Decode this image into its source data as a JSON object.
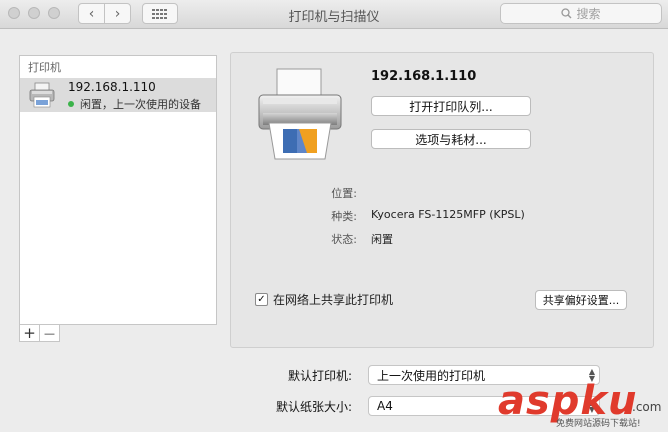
{
  "window": {
    "title": "打印机与扫描仪",
    "search_placeholder": "搜索",
    "back_glyph": "‹",
    "forward_glyph": "›",
    "grid_glyph": "⋮⋮⋮"
  },
  "sidebar": {
    "header": "打印机",
    "printers": [
      {
        "name": "192.168.1.110",
        "status": "闲置，上一次使用的设备",
        "status_color": "#3bb34a"
      }
    ],
    "add_label": "+",
    "remove_label": "—"
  },
  "detail": {
    "printer_name": "192.168.1.110",
    "open_queue_label": "打开打印队列...",
    "options_supplies_label": "选项与耗材...",
    "info": [
      {
        "label": "位置:",
        "value": ""
      },
      {
        "label": "种类:",
        "value": "Kyocera FS-1125MFP (KPSL)"
      },
      {
        "label": "状态:",
        "value": "闲置"
      }
    ],
    "share_checkbox_checked": true,
    "share_checkbox_mark": "✓",
    "share_label": "在网络上共享此打印机",
    "share_prefs_label": "共享偏好设置..."
  },
  "bottom": {
    "default_printer_label": "默认打印机:",
    "default_printer_value": "上一次使用的打印机",
    "default_paper_label": "默认纸张大小:",
    "default_paper_value": "A4"
  },
  "watermark": {
    "text": "aspku",
    "com": ".com",
    "subtitle": "免费网站源码下载站!"
  }
}
